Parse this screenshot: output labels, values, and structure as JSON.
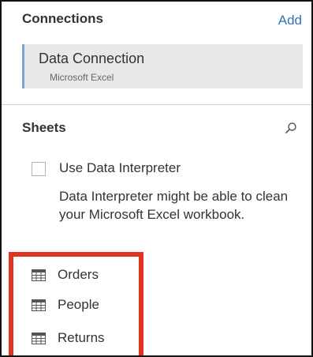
{
  "connections": {
    "title": "Connections",
    "add_label": "Add",
    "items": [
      {
        "name": "Data Connection",
        "type": "Microsoft Excel",
        "accent_color": "#7ba8cf"
      }
    ]
  },
  "sheets": {
    "title": "Sheets",
    "search_icon": "search-icon",
    "data_interpreter": {
      "checkbox_label": "Use Data Interpreter",
      "checked": false,
      "description": "Data Interpreter might be able to clean your Microsoft Excel workbook."
    },
    "items": [
      {
        "label": "Orders",
        "icon": "table-icon"
      },
      {
        "label": "People",
        "icon": "table-icon"
      },
      {
        "label": "Returns",
        "icon": "table-icon"
      }
    ]
  },
  "colors": {
    "link": "#2f74b5",
    "highlight": "#e0341f",
    "card_background": "#e8e8e8"
  }
}
